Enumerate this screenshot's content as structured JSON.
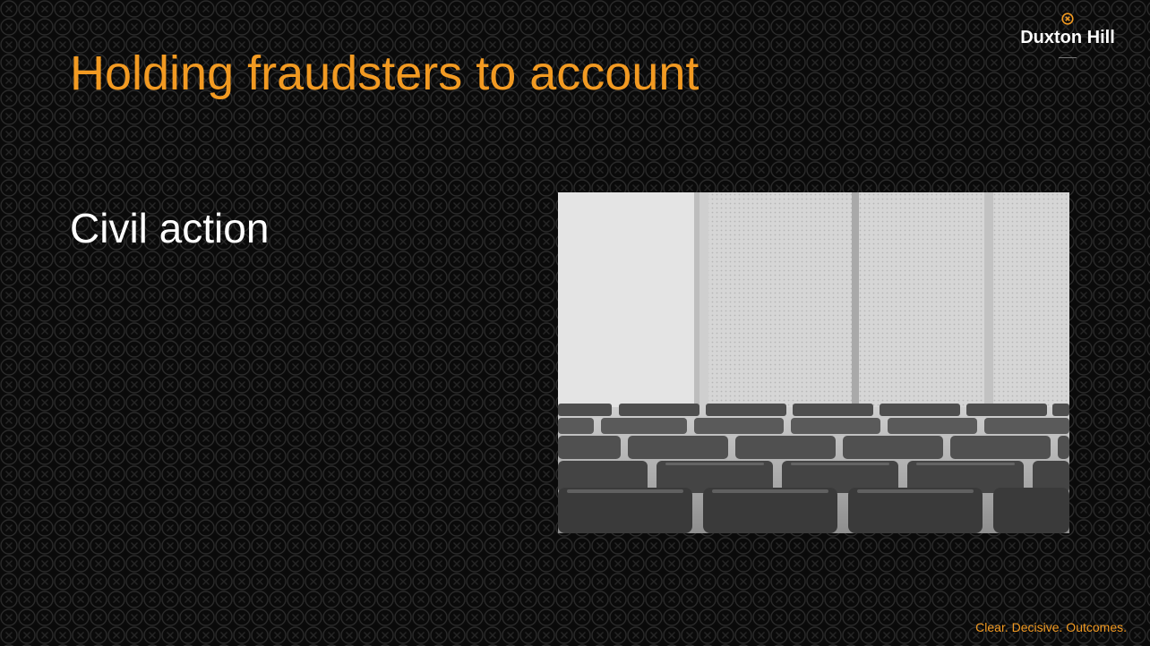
{
  "slide": {
    "title": "Holding fraudsters to account",
    "body_text": "Civil action",
    "tagline": "Clear.  Decisive.  Outcomes."
  },
  "logo": {
    "text": "Duxton Hill",
    "icon": "circled-x-icon"
  },
  "image": {
    "subject": "empty courtroom seating",
    "icon": "photo"
  },
  "colors": {
    "accent": "#f29a22",
    "background": "#0a0a0a",
    "text": "#ffffff"
  }
}
